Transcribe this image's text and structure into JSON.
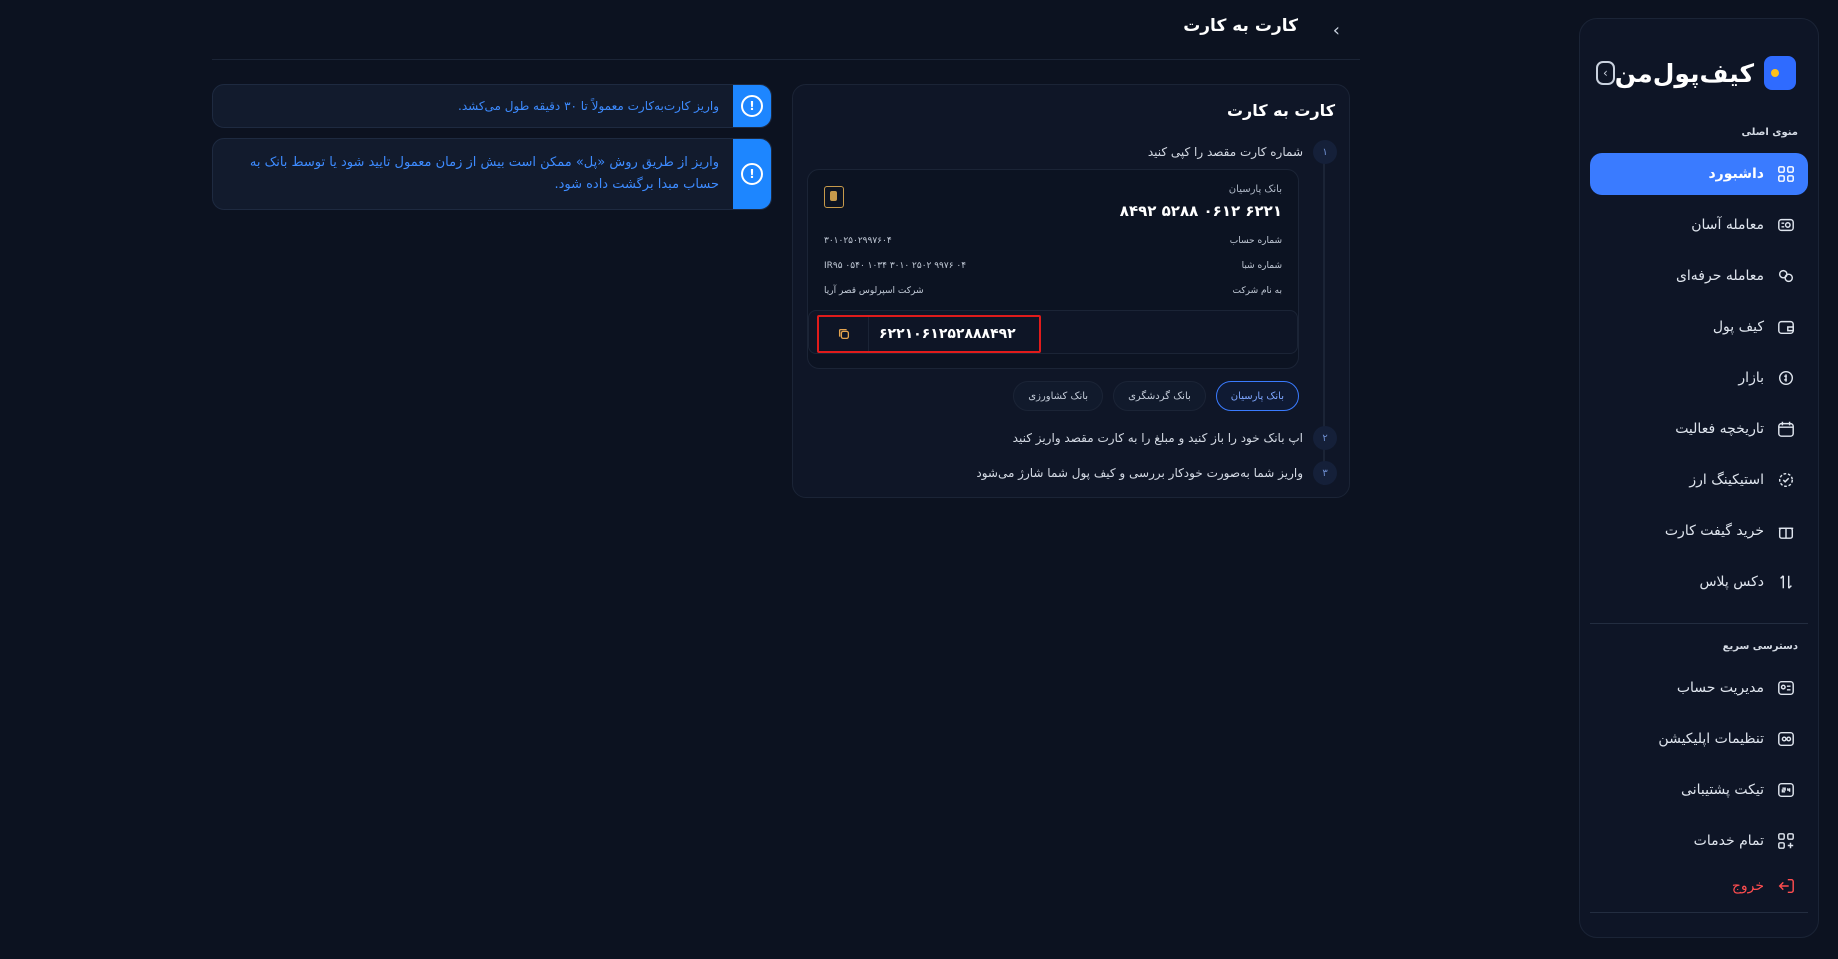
{
  "app": {
    "brand": "کیف‌پول‌من"
  },
  "sidebar": {
    "main_label": "منوی اصلی",
    "items": [
      {
        "label": "داشبورد",
        "icon": "grid-icon",
        "active": true
      },
      {
        "label": "معامله آسان",
        "icon": "easy-trade-icon"
      },
      {
        "label": "معامله حرفه‌ای",
        "icon": "pro-trade-icon"
      },
      {
        "label": "کیف پول",
        "icon": "wallet-icon"
      },
      {
        "label": "بازار",
        "icon": "market-icon"
      },
      {
        "label": "تاریخچه فعالیت",
        "icon": "calendar-icon"
      },
      {
        "label": "استیکینگ ارز",
        "icon": "staking-icon"
      },
      {
        "label": "خرید گیفت کارت",
        "icon": "gift-icon"
      },
      {
        "label": "دکس پلاس",
        "icon": "dex-icon"
      }
    ],
    "quick_label": "دسترسی سریع",
    "quick_items": [
      {
        "label": "مدیریت حساب",
        "icon": "account-icon"
      },
      {
        "label": "تنظیمات اپلیکیشن",
        "icon": "settings-icon"
      },
      {
        "label": "تیکت پشتیبانی",
        "icon": "support-icon"
      },
      {
        "label": "تمام خدمات",
        "icon": "services-icon"
      }
    ],
    "logout": "خروج"
  },
  "header": {
    "title": "کارت به کارت"
  },
  "card": {
    "title": "کارت به کارت",
    "step1": {
      "num": "۱",
      "text": "شماره کارت مقصد را کپی کنید"
    },
    "step2": {
      "num": "۲",
      "text": "اپ بانک خود را باز کنید و مبلغ را به کارت مقصد واریز کنید"
    },
    "step3": {
      "num": "۳",
      "text": "واریز شما به‌صورت خودکار بررسی و کیف پول شما شارژ می‌شود"
    },
    "bank": {
      "name": "بانک پارسیان",
      "card_number": "۶۲۲۱ ۰۶۱۲ ۵۲۸۸ ۸۴۹۲",
      "account_label": "شماره حساب",
      "account_value": "۳۰۱۰۲۵۰۲۹۹۷۶۰۴",
      "sheba_label": "شماره شبا",
      "sheba_value": "IR۹۵ ۰۵۴۰ ۱۰۳۴ ۳۰۱۰ ۲۵۰۲ ۹۹۷۶ ۰۴",
      "owner_label": "به نام شرکت",
      "owner_value": "شرکت اسپرلوس قصر آریا",
      "copy_value": "۶۲۲۱۰۶۱۲۵۲۸۸۸۴۹۲"
    },
    "tabs": [
      "بانک پارسیان",
      "بانک گردشگری",
      "بانک کشاورزی"
    ]
  },
  "alerts": {
    "first": "واریز کارت‌به‌کارت معمولاً تا ۳۰ دقیقه طول می‌کشد.",
    "second": "واریز از طریق روش «پل» ممکن است بیش از زمان معمول تایید شود یا توسط بانک به حساب مبدا برگشت داده شود."
  },
  "colors": {
    "accent": "#3a7bff",
    "alert": "#1d86ff",
    "danger": "#ff4d4f",
    "highlight": "#e01b1b"
  }
}
